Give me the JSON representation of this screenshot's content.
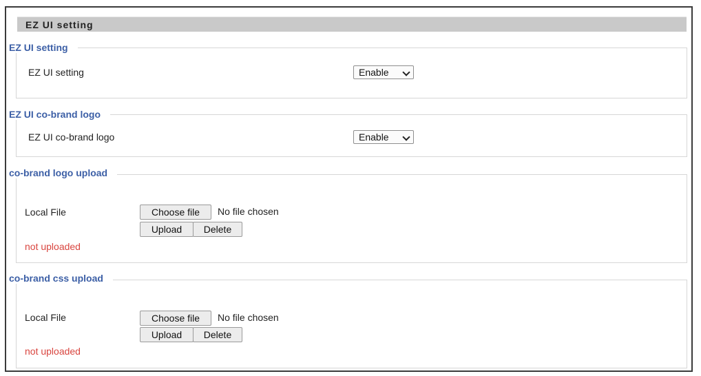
{
  "header": {
    "title": "EZ UI setting"
  },
  "sections": {
    "ez_ui": {
      "legend": "EZ UI setting",
      "label": "EZ UI setting",
      "select_value": "Enable"
    },
    "cobrand_logo": {
      "legend": "EZ UI co-brand logo",
      "label": "EZ UI co-brand logo",
      "select_value": "Enable"
    },
    "logo_upload": {
      "legend": "co-brand logo upload",
      "local_file_label": "Local File",
      "choose_file_label": "Choose file",
      "no_file_text": "No file chosen",
      "upload_label": "Upload",
      "delete_label": "Delete",
      "status": "not uploaded"
    },
    "css_upload": {
      "legend": "co-brand css upload",
      "local_file_label": "Local File",
      "choose_file_label": "Choose file",
      "no_file_text": "No file chosen",
      "upload_label": "Upload",
      "delete_label": "Delete",
      "status": "not uploaded"
    }
  },
  "colors": {
    "legend": "#3c5fa6",
    "status_error": "#d9453f",
    "header_bar": "#c9c9c9"
  },
  "icons": {
    "select_arrow": "chevron-down-icon"
  }
}
